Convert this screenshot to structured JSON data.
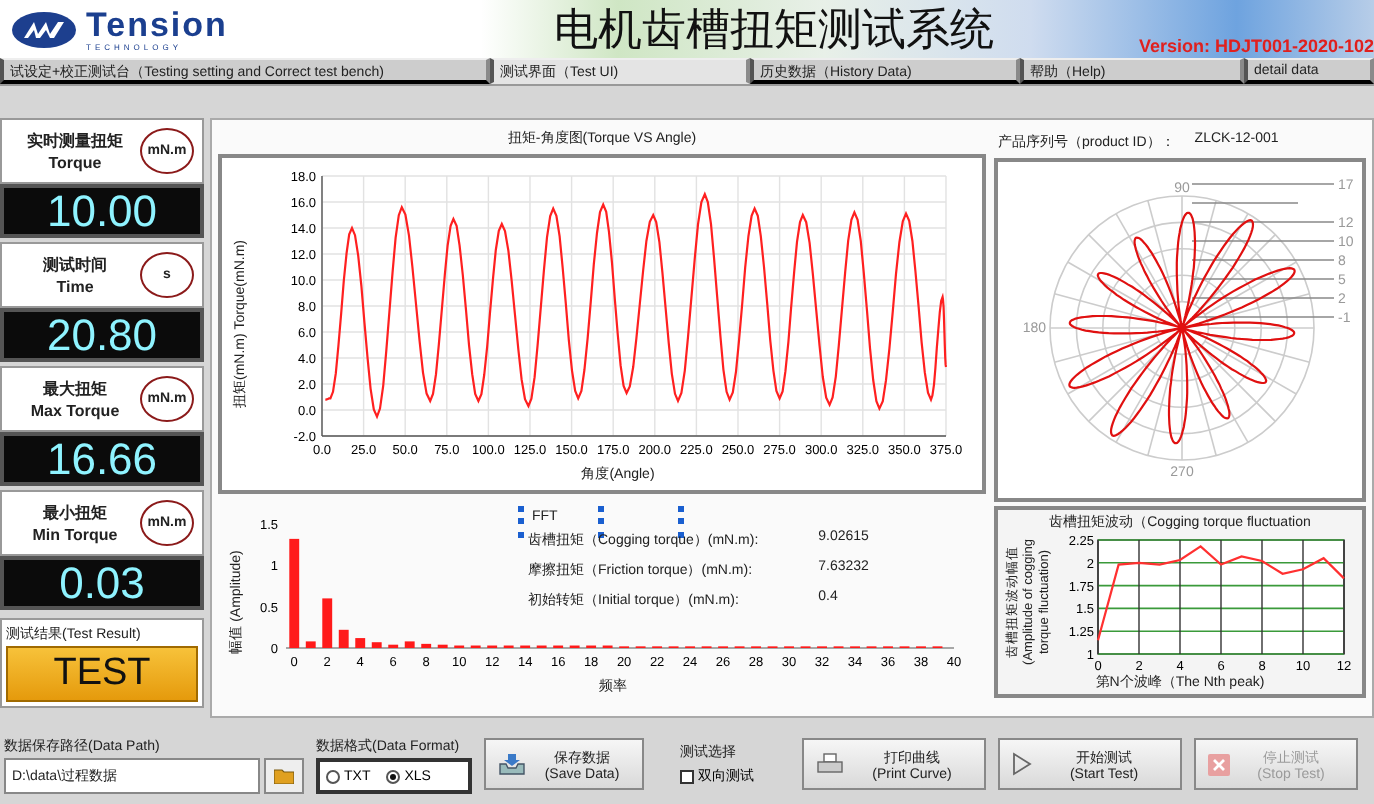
{
  "header": {
    "logo_text": "Tension",
    "logo_subtext": "TECHNOLOGY",
    "title": "电机齿槽扭矩测试系统",
    "version": "Version: HDJT001-2020-102"
  },
  "tabs": [
    {
      "label": "试设定+校正测试台（Testing setting and Correct test bench)",
      "selected": false
    },
    {
      "label": "测试界面（Test UI)",
      "selected": true
    },
    {
      "label": "历史数据（History Data)",
      "selected": false
    },
    {
      "label": "帮助（Help)",
      "selected": false
    },
    {
      "label": "detail data",
      "selected": false
    }
  ],
  "readouts": [
    {
      "label_cn": "实时测量扭矩",
      "label_en": "Torque",
      "unit": "mN.m",
      "value": "10.00"
    },
    {
      "label_cn": "测试时间",
      "label_en": "Time",
      "unit": "s",
      "value": "20.80"
    },
    {
      "label_cn": "最大扭矩",
      "label_en": "Max Torque",
      "unit": "mN.m",
      "value": "16.66"
    },
    {
      "label_cn": "最小扭矩",
      "label_en": "Min Torque",
      "unit": "mN.m",
      "value": "0.03"
    }
  ],
  "test_result": {
    "label": "测试结果(Test Result)",
    "value": "TEST"
  },
  "torque_chart": {
    "chart_data": {
      "type": "line",
      "title": "扭矩-角度图(Torque VS Angle)",
      "xlabel": "角度(Angle)",
      "ylabel": "扭矩(mN.m) Torque(mN.m)",
      "x": [
        2,
        5,
        18,
        33,
        48,
        65,
        79,
        94,
        108,
        124,
        139,
        154,
        169,
        183,
        199,
        214,
        230,
        245,
        260,
        275,
        289,
        305,
        320,
        335,
        351,
        366,
        373,
        375
      ],
      "grid": true,
      "series": [
        {
          "color": "#ff2020",
          "values": [
            0.8,
            0.9,
            14.0,
            -0.5,
            15.6,
            0.7,
            14.7,
            0.7,
            14.3,
            0.3,
            15.5,
            0.9,
            15.8,
            1.3,
            15.0,
            0.7,
            16.6,
            0.8,
            15.5,
            0.9,
            15.0,
            0.4,
            15.2,
            0.1,
            15.1,
            0.8,
            8.7,
            3.3
          ]
        }
      ],
      "xlim": [
        0,
        375
      ],
      "ylim": [
        -2,
        18
      ],
      "xticks": [
        {
          "value": 0,
          "label": "0.0"
        },
        {
          "value": 25,
          "label": "25.0"
        },
        {
          "value": 50,
          "label": "50.0"
        },
        {
          "value": 75,
          "label": "75.0"
        },
        {
          "value": 100,
          "label": "100.0"
        },
        {
          "value": 125,
          "label": "125.0"
        },
        {
          "value": 150,
          "label": "150.0"
        },
        {
          "value": 175,
          "label": "175.0"
        },
        {
          "value": 200,
          "label": "200.0"
        },
        {
          "value": 225,
          "label": "225.0"
        },
        {
          "value": 250,
          "label": "250.0"
        },
        {
          "value": 275,
          "label": "275.0"
        },
        {
          "value": 300,
          "label": "300.0"
        },
        {
          "value": 325,
          "label": "325.0"
        },
        {
          "value": 350,
          "label": "350.0"
        },
        {
          "value": 375,
          "label": "375.0"
        }
      ],
      "yticks": [
        {
          "value": -2,
          "label": "-2.0"
        },
        {
          "value": 0,
          "label": "0.0"
        },
        {
          "value": 2,
          "label": "2.0"
        },
        {
          "value": 4,
          "label": "4.0"
        },
        {
          "value": 6,
          "label": "6.0"
        },
        {
          "value": 8,
          "label": "8.0"
        },
        {
          "value": 10,
          "label": "10.0"
        },
        {
          "value": 12,
          "label": "12.0"
        },
        {
          "value": 14,
          "label": "14.0"
        },
        {
          "value": 16,
          "label": "16.0"
        },
        {
          "value": 18,
          "label": "18.0"
        }
      ]
    }
  },
  "product": {
    "label": "产品序列号（product ID）：",
    "value": "ZLCK-12-001"
  },
  "polar": {
    "angle_labels": [
      "90",
      "180",
      "270"
    ],
    "radial_labels": [
      "17",
      "12",
      "10",
      "8",
      "5",
      "2",
      "-1"
    ]
  },
  "fft": {
    "label": "FFT",
    "chart_data": {
      "type": "bar",
      "xlabel": "频率",
      "ylabel": "幅值 (Amplitude)",
      "x": [
        0,
        1,
        2,
        3,
        4,
        5,
        6,
        7,
        8,
        9,
        10,
        11,
        12,
        13,
        14,
        15,
        16,
        17,
        18,
        19,
        20,
        21,
        22,
        23,
        24,
        25,
        26,
        27,
        28,
        29,
        30,
        31,
        32,
        33,
        34,
        35,
        36,
        37,
        38,
        39
      ],
      "series": [
        {
          "color": "#ff1a1a",
          "values": [
            1.32,
            0.08,
            0.6,
            0.22,
            0.12,
            0.07,
            0.04,
            0.08,
            0.05,
            0.04,
            0.03,
            0.03,
            0.03,
            0.03,
            0.03,
            0.03,
            0.03,
            0.03,
            0.03,
            0.03,
            0.02,
            0.02,
            0.02,
            0.02,
            0.02,
            0.02,
            0.02,
            0.02,
            0.02,
            0.02,
            0.02,
            0.02,
            0.02,
            0.02,
            0.02,
            0.02,
            0.02,
            0.02,
            0.02,
            0.02
          ]
        }
      ],
      "xlim": [
        -0.5,
        40
      ],
      "ylim": [
        0,
        1.5
      ],
      "xticks": [
        0,
        2,
        4,
        6,
        8,
        10,
        12,
        14,
        16,
        18,
        20,
        22,
        24,
        26,
        28,
        30,
        32,
        34,
        36,
        38,
        40
      ],
      "yticks": [
        0,
        0.5,
        1,
        1.5
      ]
    }
  },
  "results": [
    {
      "label": "齿槽扭矩（Cogging torque）(mN.m):",
      "value": "9.02615"
    },
    {
      "label": "摩擦扭矩（Friction torque）(mN.m):",
      "value": "7.63232"
    },
    {
      "label": "初始转矩（Initial torque）(mN.m):",
      "value": "0.4"
    }
  ],
  "fluctuation": {
    "chart_data": {
      "type": "line",
      "title": "齿槽扭矩波动（Cogging torque fluctuation",
      "xlabel": "第N个波峰（The Nth peak)",
      "ylabel": "齿槽扭矩波动幅值 (Amplitude of cogging torque fluctuation)",
      "x": [
        0,
        1,
        2,
        3,
        4,
        5,
        6,
        7,
        8,
        9,
        10,
        11,
        12
      ],
      "grid": true,
      "series": [
        {
          "color": "#ff3030",
          "values": [
            1.15,
            1.98,
            2.0,
            1.98,
            2.03,
            2.18,
            1.98,
            2.07,
            2.02,
            1.88,
            1.93,
            2.05,
            1.83
          ]
        }
      ],
      "xlim": [
        0,
        12
      ],
      "ylim": [
        1,
        2.25
      ],
      "xticks": [
        0,
        2,
        4,
        6,
        8,
        10,
        12
      ],
      "yticks": [
        1,
        1.25,
        1.5,
        1.75,
        2,
        2.25
      ]
    }
  },
  "data_path": {
    "label": "数据保存路径(Data Path)",
    "value": "D:\\data\\过程数据"
  },
  "data_format": {
    "label": "数据格式(Data Format)",
    "options": [
      {
        "label": "TXT",
        "selected": false
      },
      {
        "label": "XLS",
        "selected": true
      }
    ]
  },
  "test_select": {
    "label": "测试选择",
    "option": {
      "label": "双向测试",
      "checked": false
    }
  },
  "buttons": [
    {
      "kind": "save",
      "label_cn": "保存数据",
      "label_en": "(Save Data)",
      "disabled": false
    },
    {
      "kind": "print",
      "label_cn": "打印曲线",
      "label_en": "(Print Curve)",
      "disabled": false
    },
    {
      "kind": "start",
      "label_cn": "开始测试",
      "label_en": "(Start Test)",
      "disabled": false
    },
    {
      "kind": "stop",
      "label_cn": "停止测试",
      "label_en": "(Stop Test)",
      "disabled": true
    }
  ]
}
